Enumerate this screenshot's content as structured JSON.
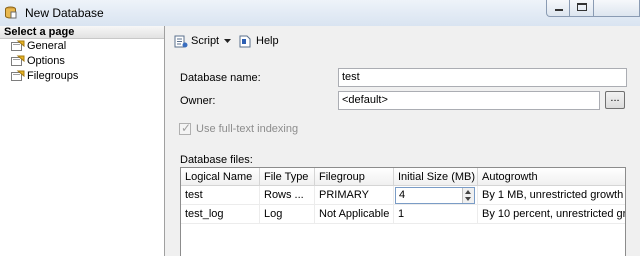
{
  "window": {
    "title": "New Database",
    "app_icon": "database-icon"
  },
  "nav": {
    "header": "Select a page",
    "items": [
      {
        "label": "General",
        "icon": "page-icon",
        "selected": true
      },
      {
        "label": "Options",
        "icon": "page-icon",
        "selected": false
      },
      {
        "label": "Filegroups",
        "icon": "page-icon",
        "selected": false
      }
    ]
  },
  "toolbar": {
    "script_label": "Script",
    "help_label": "Help"
  },
  "form": {
    "db_name_label": "Database name:",
    "db_name_value": "test",
    "owner_label": "Owner:",
    "owner_value": "<default>",
    "browse_label": "...",
    "fulltext_label": "Use full-text indexing",
    "fulltext_checked": true,
    "files_label": "Database files:"
  },
  "grid": {
    "columns": [
      "Logical Name",
      "File Type",
      "Filegroup",
      "Initial Size (MB)",
      "Autogrowth"
    ],
    "rows": [
      {
        "logical_name": "test",
        "file_type": "Rows ...",
        "filegroup": "PRIMARY",
        "initial_size": "4",
        "autogrowth": "By 1 MB, unrestricted growth"
      },
      {
        "logical_name": "test_log",
        "file_type": "Log",
        "filegroup": "Not Applicable",
        "initial_size": "1",
        "autogrowth": "By 10 percent, unrestricted growt"
      }
    ]
  },
  "colors": {
    "titlebar": "#dfe8f3",
    "panel": "#f0f0f0",
    "accent_border": "#7a9cc6"
  }
}
